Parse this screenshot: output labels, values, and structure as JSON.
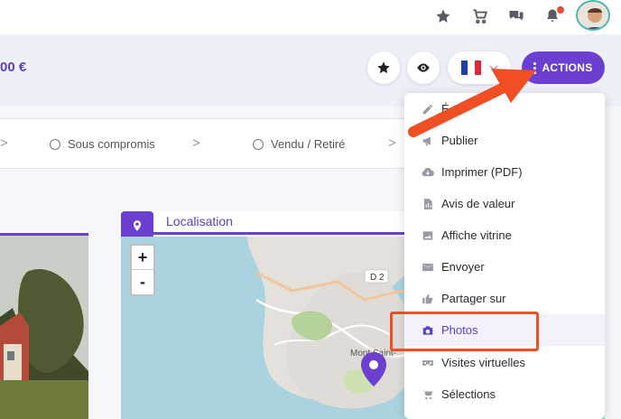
{
  "header": {
    "price": "00 €"
  },
  "topbar": {
    "icons": [
      "star-icon",
      "cart-icon",
      "chat-icon",
      "bell-icon"
    ]
  },
  "actions": {
    "label": "ACTIONS"
  },
  "language": {
    "selected": "FR"
  },
  "steps": [
    {
      "label": "Sous compromis"
    },
    {
      "label": "Vendu / Retiré"
    }
  ],
  "location": {
    "title": "Localisation",
    "map_labels": {
      "road": "D 2",
      "place": "Mont Saint-"
    },
    "zoom_in": "+",
    "zoom_out": "-"
  },
  "menu": {
    "items": [
      {
        "label": "É",
        "icon": "pencil-icon"
      },
      {
        "label": "Publier",
        "icon": "megaphone-icon"
      },
      {
        "label": "Imprimer (PDF)",
        "icon": "cloud-download-icon"
      },
      {
        "label": "Avis de valeur",
        "icon": "document-chart-icon"
      },
      {
        "label": "Affiche vitrine",
        "icon": "image-icon"
      },
      {
        "label": "Envoyer",
        "icon": "envelope-icon"
      },
      {
        "label": "Partager sur",
        "icon": "thumbs-up-icon"
      },
      {
        "label": "Photos",
        "icon": "camera-icon",
        "active": true
      },
      {
        "label": "Visites virtuelles",
        "icon": "vr-headset-icon"
      },
      {
        "label": "Sélections",
        "icon": "cart-icon"
      }
    ]
  },
  "colors": {
    "accent": "#6b3fcf",
    "highlight": "#f04e23"
  }
}
